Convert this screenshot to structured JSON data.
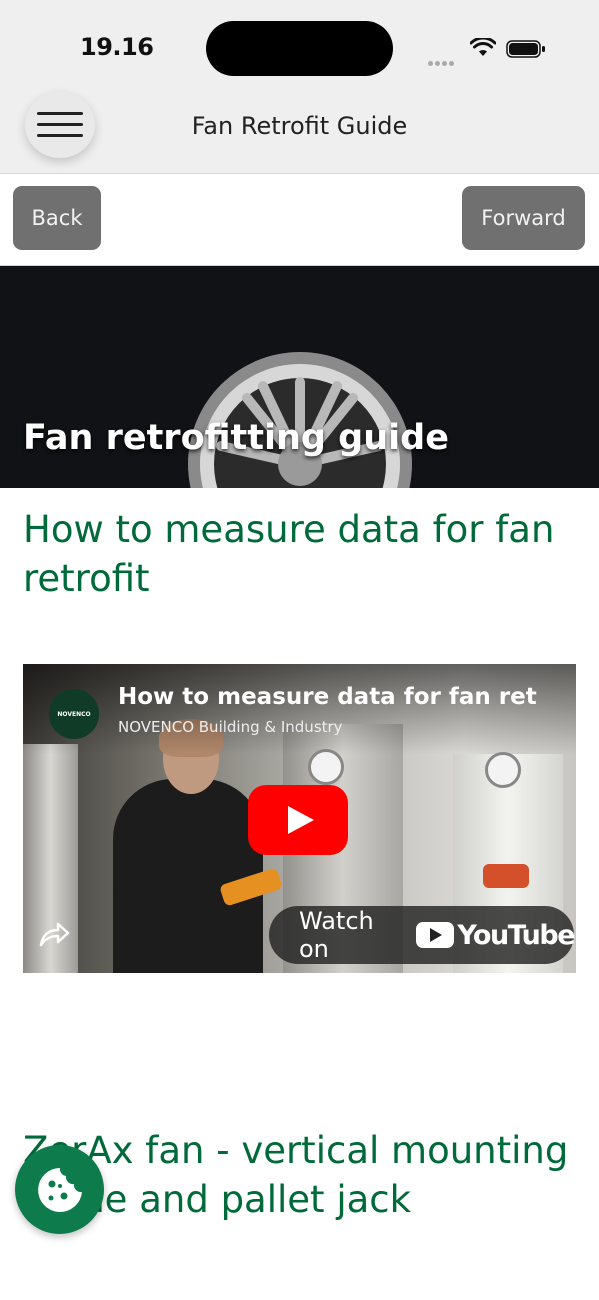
{
  "status_bar": {
    "time": "19.16"
  },
  "header": {
    "title": "Fan Retrofit Guide"
  },
  "nav": {
    "back_label": "Back",
    "forward_label": "Forward"
  },
  "hero": {
    "title": "Fan retrofitting guide"
  },
  "sections": [
    {
      "heading": "How to measure data for fan retrofit",
      "video": {
        "title": "How to measure data for fan ret",
        "channel": "NOVENCO Building & Industry",
        "logo_text": "NOVENCO",
        "watch_label": "Watch on",
        "platform": "YouTube"
      }
    },
    {
      "heading": "ZerAx fan - vertical mounting crane and pallet jack"
    }
  ],
  "colors": {
    "accent_green": "#006a3a",
    "cookie_green": "#0e7b4d",
    "nav_button": "#707070",
    "youtube_red": "#ff0000"
  },
  "icons": [
    "menu-icon",
    "wifi-icon",
    "battery-icon",
    "share-icon",
    "play-icon",
    "cookie-icon"
  ]
}
